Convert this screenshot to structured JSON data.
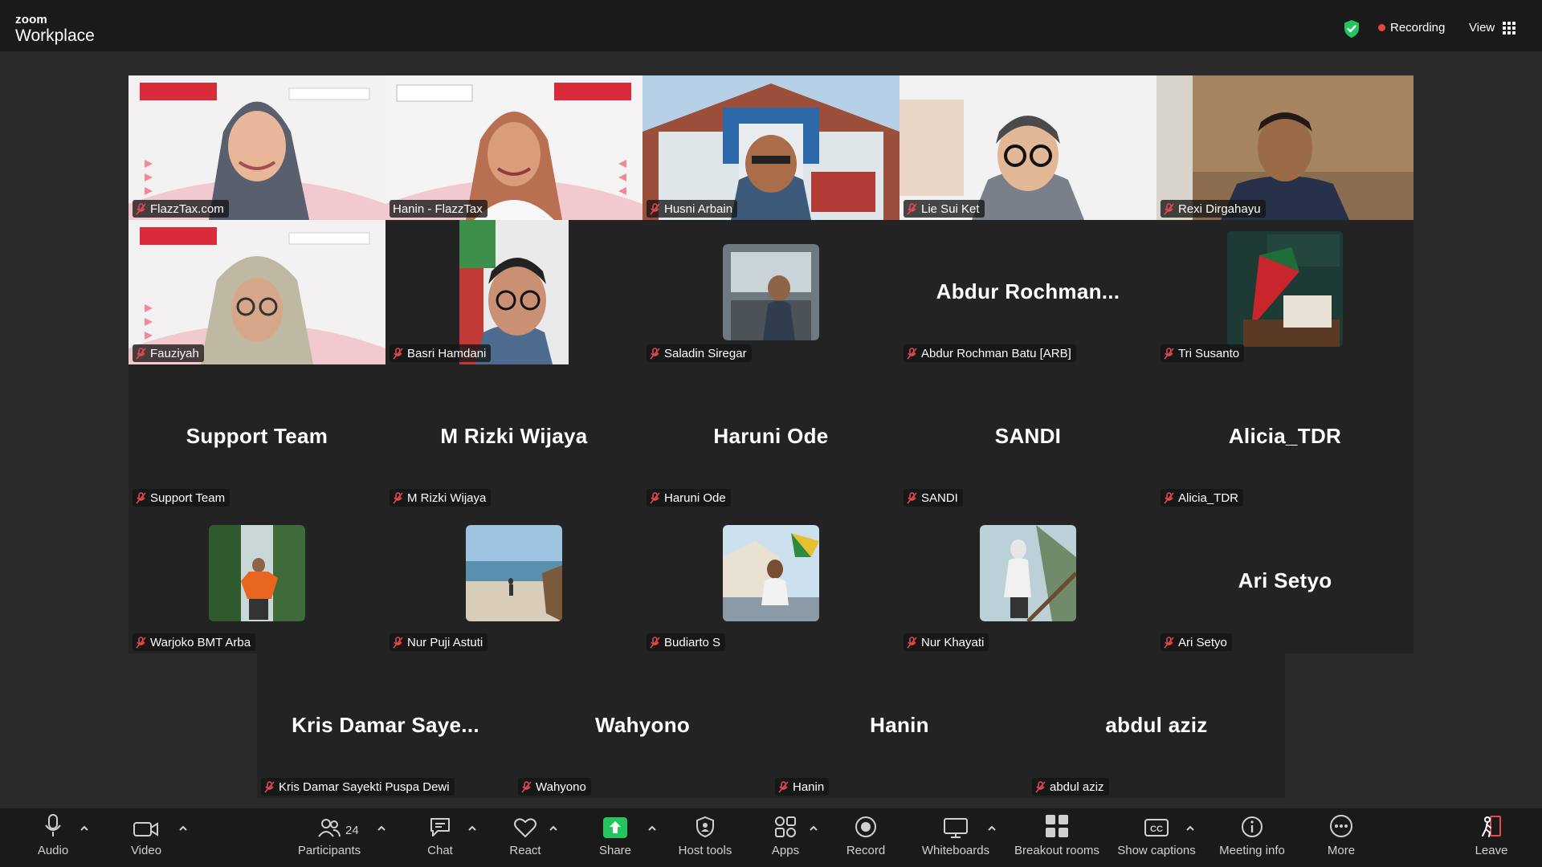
{
  "app": {
    "brand_top": "zoom",
    "brand_bottom": "Workplace"
  },
  "header": {
    "recording_label": "Recording",
    "view_label": "View"
  },
  "colors": {
    "active_speaker": "#22d36b",
    "recording_dot": "#e8453c",
    "share_green": "#22c55e",
    "leave_red": "#e5484d",
    "muted_mic": "#e5484d"
  },
  "participants": [
    {
      "name": "FlazzTax.com",
      "big": ""
    },
    {
      "name": "Hanin - FlazzTax",
      "big": ""
    },
    {
      "name": "Husni Arbain",
      "big": ""
    },
    {
      "name": "Lie Sui Ket",
      "big": ""
    },
    {
      "name": "Rexi Dirgahayu",
      "big": ""
    },
    {
      "name": "Fauziyah",
      "big": ""
    },
    {
      "name": "Basri Hamdani",
      "big": ""
    },
    {
      "name": "Saladin Siregar",
      "big": ""
    },
    {
      "name": "Abdur Rochman Batu [ARB]",
      "big": "Abdur  Rochman..."
    },
    {
      "name": "Tri Susanto",
      "big": ""
    },
    {
      "name": "Support Team",
      "big": "Support Team"
    },
    {
      "name": "M Rizki Wijaya",
      "big": "M Rizki Wijaya"
    },
    {
      "name": "Haruni Ode",
      "big": "Haruni Ode"
    },
    {
      "name": "SANDI",
      "big": "SANDI"
    },
    {
      "name": "Alicia_TDR",
      "big": "Alicia_TDR"
    },
    {
      "name": "Warjoko BMT Arba",
      "big": ""
    },
    {
      "name": "Nur Puji Astuti",
      "big": ""
    },
    {
      "name": "Budiarto S",
      "big": ""
    },
    {
      "name": "Nur Khayati",
      "big": ""
    },
    {
      "name": "Ari Setyo",
      "big": "Ari Setyo"
    },
    {
      "name": "Kris Damar Sayekti Puspa Dewi",
      "big": "Kris  Damar  Saye..."
    },
    {
      "name": "Wahyono",
      "big": "Wahyono"
    },
    {
      "name": "Hanin",
      "big": "Hanin"
    },
    {
      "name": "abdul aziz",
      "big": "abdul aziz"
    }
  ],
  "toolbar": {
    "audio": "Audio",
    "video": "Video",
    "participants": "Participants",
    "participants_count": "24",
    "chat": "Chat",
    "react": "React",
    "share": "Share",
    "host_tools": "Host tools",
    "apps": "Apps",
    "record": "Record",
    "whiteboards": "Whiteboards",
    "breakout_rooms": "Breakout rooms",
    "show_captions": "Show captions",
    "meeting_info": "Meeting info",
    "more": "More",
    "leave": "Leave"
  },
  "icons": [
    "shield-check-icon",
    "grid-view-icon",
    "mic-icon",
    "camera-icon",
    "participants-icon",
    "chat-icon",
    "heart-icon",
    "share-arrow-icon",
    "host-shield-icon",
    "apps-icon",
    "record-icon",
    "whiteboard-icon",
    "breakout-grid-icon",
    "cc-icon",
    "info-icon",
    "more-dots-icon",
    "leave-icon",
    "muted-mic-icon"
  ]
}
